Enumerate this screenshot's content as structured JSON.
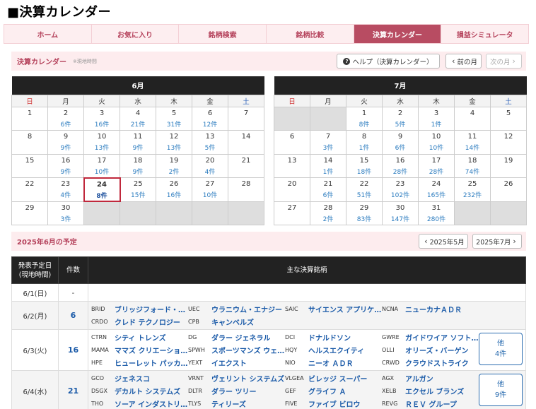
{
  "page_title": "■決算カレンダー",
  "nav": [
    "ホーム",
    "お気に入り",
    "銘柄検索",
    "銘柄比較",
    "決算カレンダー",
    "損益シミュレータ"
  ],
  "nav_active": 4,
  "calendar_bar": {
    "title": "決算カレンダー",
    "note": "※現地時間",
    "help_label": "ヘルプ（決算カレンダー）",
    "prev_label": "前の月",
    "next_label": "次の月"
  },
  "weekdays": [
    "日",
    "月",
    "火",
    "水",
    "木",
    "金",
    "土"
  ],
  "calendars": [
    {
      "month": "6月",
      "weeks": [
        [
          {
            "d": "1"
          },
          {
            "d": "2",
            "c": "6件"
          },
          {
            "d": "3",
            "c": "16件"
          },
          {
            "d": "4",
            "c": "21件"
          },
          {
            "d": "5",
            "c": "31件"
          },
          {
            "d": "6",
            "c": "12件"
          },
          {
            "d": "7"
          }
        ],
        [
          {
            "d": "8"
          },
          {
            "d": "9",
            "c": "9件"
          },
          {
            "d": "10",
            "c": "13件"
          },
          {
            "d": "11",
            "c": "9件"
          },
          {
            "d": "12",
            "c": "13件"
          },
          {
            "d": "13",
            "c": "5件"
          },
          {
            "d": "14"
          }
        ],
        [
          {
            "d": "15"
          },
          {
            "d": "16",
            "c": "9件"
          },
          {
            "d": "17",
            "c": "10件"
          },
          {
            "d": "18",
            "c": "9件"
          },
          {
            "d": "19",
            "c": "2件"
          },
          {
            "d": "20",
            "c": "4件"
          },
          {
            "d": "21"
          }
        ],
        [
          {
            "d": "22"
          },
          {
            "d": "23",
            "c": "4件"
          },
          {
            "d": "24",
            "c": "8件",
            "today": true
          },
          {
            "d": "25",
            "c": "15件"
          },
          {
            "d": "26",
            "c": "16件"
          },
          {
            "d": "27",
            "c": "10件"
          },
          {
            "d": "28"
          }
        ],
        [
          {
            "d": "29"
          },
          {
            "d": "30",
            "c": "3件"
          },
          {
            "blank": true
          },
          {
            "blank": true
          },
          {
            "blank": true
          },
          {
            "blank": true
          },
          {
            "blank": true
          }
        ]
      ]
    },
    {
      "month": "7月",
      "weeks": [
        [
          {
            "blank": true
          },
          {
            "blank": true
          },
          {
            "d": "1",
            "c": "8件"
          },
          {
            "d": "2",
            "c": "5件"
          },
          {
            "d": "3",
            "c": "1件"
          },
          {
            "d": "4"
          },
          {
            "d": "5"
          }
        ],
        [
          {
            "d": "6"
          },
          {
            "d": "7",
            "c": "3件"
          },
          {
            "d": "8",
            "c": "1件"
          },
          {
            "d": "9",
            "c": "6件"
          },
          {
            "d": "10",
            "c": "10件"
          },
          {
            "d": "11",
            "c": "14件"
          },
          {
            "d": "12"
          }
        ],
        [
          {
            "d": "13"
          },
          {
            "d": "14",
            "c": "1件"
          },
          {
            "d": "15",
            "c": "18件"
          },
          {
            "d": "16",
            "c": "28件"
          },
          {
            "d": "17",
            "c": "28件"
          },
          {
            "d": "18",
            "c": "74件"
          },
          {
            "d": "19"
          }
        ],
        [
          {
            "d": "20"
          },
          {
            "d": "21",
            "c": "6件"
          },
          {
            "d": "22",
            "c": "51件"
          },
          {
            "d": "23",
            "c": "102件"
          },
          {
            "d": "24",
            "c": "165件"
          },
          {
            "d": "25",
            "c": "232件"
          },
          {
            "d": "26"
          }
        ],
        [
          {
            "d": "27"
          },
          {
            "d": "28",
            "c": "2件"
          },
          {
            "d": "29",
            "c": "83件"
          },
          {
            "d": "30",
            "c": "147件"
          },
          {
            "d": "31",
            "c": "280件"
          },
          {
            "blank": true
          },
          {
            "blank": true
          }
        ]
      ]
    }
  ],
  "schedule_bar": {
    "title": "2025年6月の予定",
    "prev_label": "2025年5月",
    "next_label": "2025年7月"
  },
  "schedule": {
    "headers": {
      "date_line1": "発表予定日",
      "date_line2": "(現地時間)",
      "count": "件数",
      "stocks": "主な決算銘柄"
    },
    "rows": [
      {
        "date": "6/1(日)",
        "count": "-",
        "lines": []
      },
      {
        "date": "6/2(月)",
        "count": "6",
        "lines": [
          [
            {
              "t": "BRID",
              "n": "ブリッジフォード・フーズ"
            },
            {
              "t": "UEC",
              "n": "ウラニウム・エナジー"
            },
            {
              "t": "SAIC",
              "n": "サイエンス アプリケーションズ"
            },
            {
              "t": "NCNA",
              "n": "ニューカナＡＤＲ"
            }
          ],
          [
            {
              "t": "CRDO",
              "n": "クレド テクノロジー"
            },
            {
              "t": "CPB",
              "n": "キャンベルズ"
            }
          ]
        ]
      },
      {
        "date": "6/3(火)",
        "count": "16",
        "more": {
          "line1": "他",
          "line2": "4件"
        },
        "lines": [
          [
            {
              "t": "CTRN",
              "n": "シティ トレンズ"
            },
            {
              "t": "DG",
              "n": "ダラー ジェネラル"
            },
            {
              "t": "DCI",
              "n": "ドナルドソン"
            },
            {
              "t": "GWRE",
              "n": "ガイドワイア ソフトウェア"
            }
          ],
          [
            {
              "t": "MAMA",
              "n": "ママズ クリエーションズ"
            },
            {
              "t": "SPWH",
              "n": "スポーツマンズ ウェアハウス"
            },
            {
              "t": "HQY",
              "n": "ヘルスエクイティ"
            },
            {
              "t": "OLLI",
              "n": "オリーズ・バーゲン"
            }
          ],
          [
            {
              "t": "HPE",
              "n": "ヒューレット パッカード"
            },
            {
              "t": "YEXT",
              "n": "イエクスト"
            },
            {
              "t": "NIO",
              "n": "ニーオ ＡＤＲ"
            },
            {
              "t": "CRWD",
              "n": "クラウドストライク"
            }
          ]
        ]
      },
      {
        "date": "6/4(水)",
        "count": "21",
        "more": {
          "line1": "他",
          "line2": "9件"
        },
        "lines": [
          [
            {
              "t": "GCO",
              "n": "ジェネスコ"
            },
            {
              "t": "VRNT",
              "n": "ヴェリント システムズ"
            },
            {
              "t": "VLGEA",
              "n": "ビレッジ スーパー"
            },
            {
              "t": "AGX",
              "n": "アルガン"
            }
          ],
          [
            {
              "t": "DSGX",
              "n": "デカルト システムズ"
            },
            {
              "t": "DLTR",
              "n": "ダラー ツリー"
            },
            {
              "t": "GEF",
              "n": "グライフ Ａ"
            },
            {
              "t": "XELB",
              "n": "エクセル ブランズ"
            }
          ],
          [
            {
              "t": "THO",
              "n": "ソーア インダストリーズ"
            },
            {
              "t": "TLYS",
              "n": "ティリーズ"
            },
            {
              "t": "FIVE",
              "n": "ファイブ ビロウ"
            },
            {
              "t": "REVG",
              "n": "ＲＥＶ グループ"
            }
          ]
        ]
      }
    ]
  }
}
